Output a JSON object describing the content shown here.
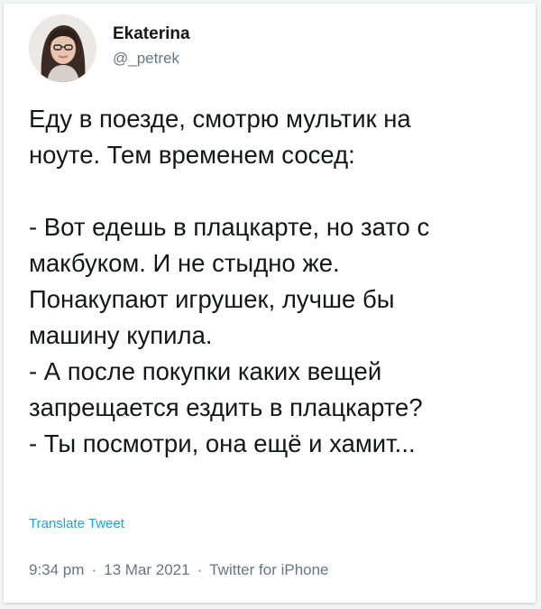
{
  "author": {
    "display_name": "Ekaterina",
    "handle": "@_petrek",
    "avatar_icon": "profile-photo"
  },
  "tweet": {
    "lines": [
      "Еду в поезде, смотрю мультик на",
      "ноуте. Тем временем сосед:",
      "",
      "- Вот едешь в плацкарте, но зато с",
      "макбуком. И не стыдно же.",
      "Понакупают игрушек, лучше бы",
      "машину купила.",
      "- А после покупки каких вещей",
      "запрещается ездить в плацкарте?",
      "- Ты посмотри, она ещё и хамит..."
    ],
    "translate_label": "Translate Tweet"
  },
  "meta": {
    "time": "9:34 pm",
    "date": "13 Mar 2021",
    "source": "Twitter for iPhone",
    "separator": "·"
  },
  "colors": {
    "text": "#14171a",
    "secondary": "#657786",
    "link": "#1da1f2"
  }
}
